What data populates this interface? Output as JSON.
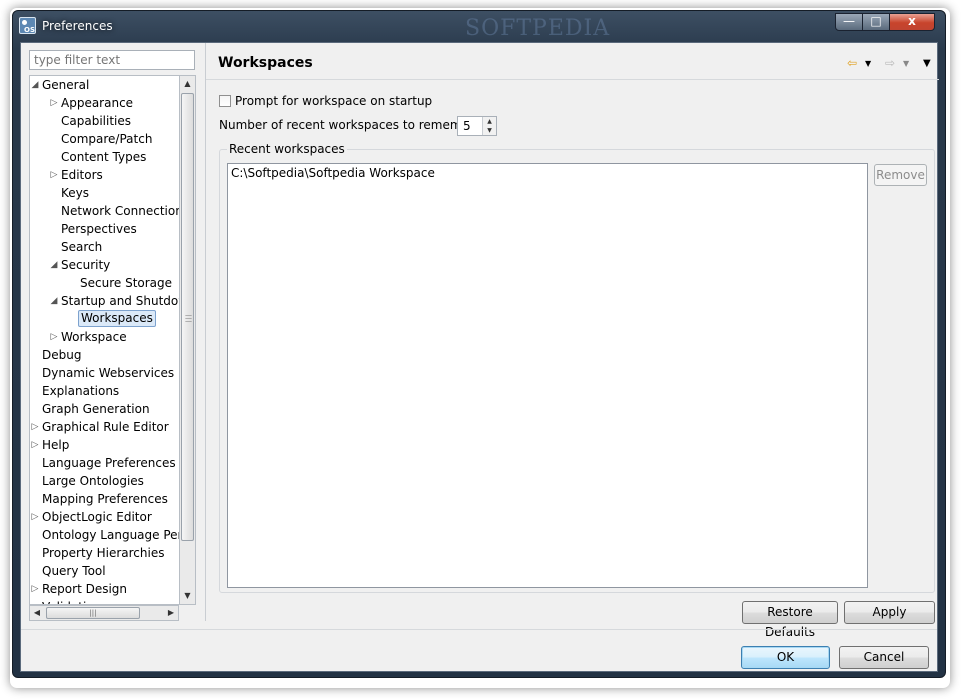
{
  "window": {
    "title": "Preferences",
    "watermark": "SOFTPEDIA",
    "minimize": "—",
    "maximize": "□",
    "close": "x"
  },
  "filter": {
    "placeholder": "type filter text"
  },
  "tree": [
    {
      "label": "General",
      "depth": 0,
      "twisty": "expanded"
    },
    {
      "label": "Appearance",
      "depth": 1,
      "twisty": "collapsed"
    },
    {
      "label": "Capabilities",
      "depth": 1,
      "twisty": "none"
    },
    {
      "label": "Compare/Patch",
      "depth": 1,
      "twisty": "none"
    },
    {
      "label": "Content Types",
      "depth": 1,
      "twisty": "none"
    },
    {
      "label": "Editors",
      "depth": 1,
      "twisty": "collapsed"
    },
    {
      "label": "Keys",
      "depth": 1,
      "twisty": "none"
    },
    {
      "label": "Network Connection",
      "depth": 1,
      "twisty": "none"
    },
    {
      "label": "Perspectives",
      "depth": 1,
      "twisty": "none"
    },
    {
      "label": "Search",
      "depth": 1,
      "twisty": "none"
    },
    {
      "label": "Security",
      "depth": 1,
      "twisty": "expanded"
    },
    {
      "label": "Secure Storage",
      "depth": 2,
      "twisty": "none"
    },
    {
      "label": "Startup and Shutdown",
      "depth": 1,
      "twisty": "expanded"
    },
    {
      "label": "Workspaces",
      "depth": 2,
      "twisty": "none",
      "selected": true
    },
    {
      "label": "Workspace",
      "depth": 1,
      "twisty": "collapsed"
    },
    {
      "label": "Debug",
      "depth": 0,
      "twisty": "none"
    },
    {
      "label": "Dynamic Webservices",
      "depth": 0,
      "twisty": "none"
    },
    {
      "label": "Explanations",
      "depth": 0,
      "twisty": "none"
    },
    {
      "label": "Graph Generation",
      "depth": 0,
      "twisty": "none"
    },
    {
      "label": "Graphical Rule Editor",
      "depth": 0,
      "twisty": "collapsed"
    },
    {
      "label": "Help",
      "depth": 0,
      "twisty": "collapsed"
    },
    {
      "label": "Language Preferences",
      "depth": 0,
      "twisty": "none"
    },
    {
      "label": "Large Ontologies",
      "depth": 0,
      "twisty": "none"
    },
    {
      "label": "Mapping Preferences",
      "depth": 0,
      "twisty": "none"
    },
    {
      "label": "ObjectLogic Editor",
      "depth": 0,
      "twisty": "collapsed"
    },
    {
      "label": "Ontology Language Perspectives",
      "depth": 0,
      "twisty": "none"
    },
    {
      "label": "Property Hierarchies",
      "depth": 0,
      "twisty": "none"
    },
    {
      "label": "Query Tool",
      "depth": 0,
      "twisty": "none"
    },
    {
      "label": "Report Design",
      "depth": 0,
      "twisty": "collapsed"
    },
    {
      "label": "Validation",
      "depth": 0,
      "twisty": "none"
    }
  ],
  "page": {
    "title": "Workspaces",
    "prompt_label": "Prompt for workspace on startup",
    "prompt_checked": false,
    "recent_count_label": "Number of recent workspaces to remember:",
    "recent_count_value": "5",
    "recent_group_label": "Recent workspaces",
    "recent_items": [
      "C:\\Softpedia\\Softpedia Workspace"
    ],
    "remove_label": "Remove"
  },
  "buttons": {
    "restore_defaults": "Restore Defaults",
    "apply": "Apply",
    "ok": "OK",
    "cancel": "Cancel"
  },
  "colors": {
    "title_bar": "#2f4156",
    "selection": "#dbe9f8",
    "nav_back": "#e8a317"
  }
}
